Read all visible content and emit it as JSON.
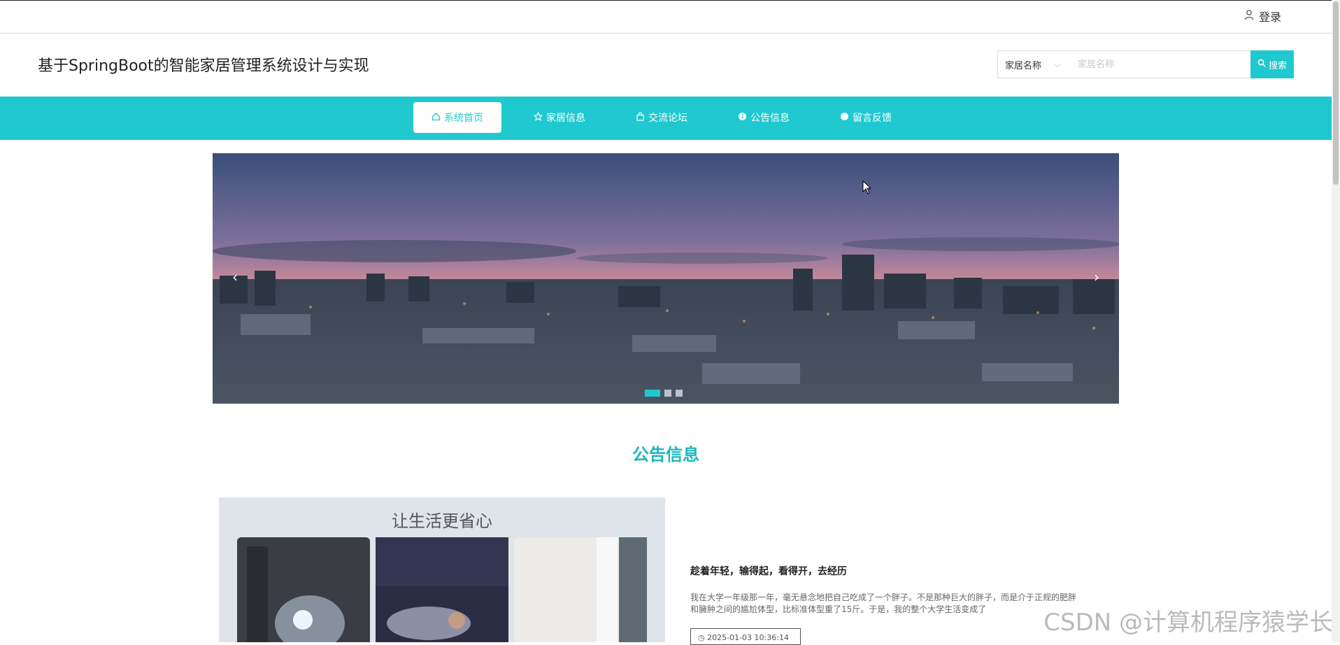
{
  "topbar": {
    "login_label": "登录"
  },
  "header": {
    "site_title": "基于SpringBoot的智能家居管理系统设计与实现",
    "search": {
      "select_value": "家居名称",
      "input_placeholder": "家居名称",
      "button_label": "搜索"
    }
  },
  "nav": {
    "items": [
      {
        "label": "系统首页",
        "icon": "home-icon",
        "active": true
      },
      {
        "label": "家居信息",
        "icon": "star-icon",
        "active": false
      },
      {
        "label": "交流论坛",
        "icon": "bag-icon",
        "active": false
      },
      {
        "label": "公告信息",
        "icon": "info-circle-icon",
        "active": false
      },
      {
        "label": "留言反馈",
        "icon": "circle-icon",
        "active": false
      }
    ]
  },
  "carousel": {
    "prev_label": "‹",
    "next_label": "›",
    "slide_count": 3,
    "active_index": 0
  },
  "notices": {
    "section_title": "公告信息",
    "image_tagline": "让生活更省心",
    "item": {
      "title": "趁着年轻，输得起，看得开，去经历",
      "body": "我在大学一年级那一年，毫无悬念地把自己吃成了一个胖子。不是那种巨大的胖子，而是介于正规的肥胖和臃肿之间的尴尬体型，比标准体型重了15斤。于是，我的整个大学生活变成了",
      "date": "2025-01-03 10:36:14"
    }
  },
  "watermark": "CSDN @计算机程序猿学长",
  "colors": {
    "accent": "#1fc9cf",
    "section_title": "#1fb6be"
  }
}
